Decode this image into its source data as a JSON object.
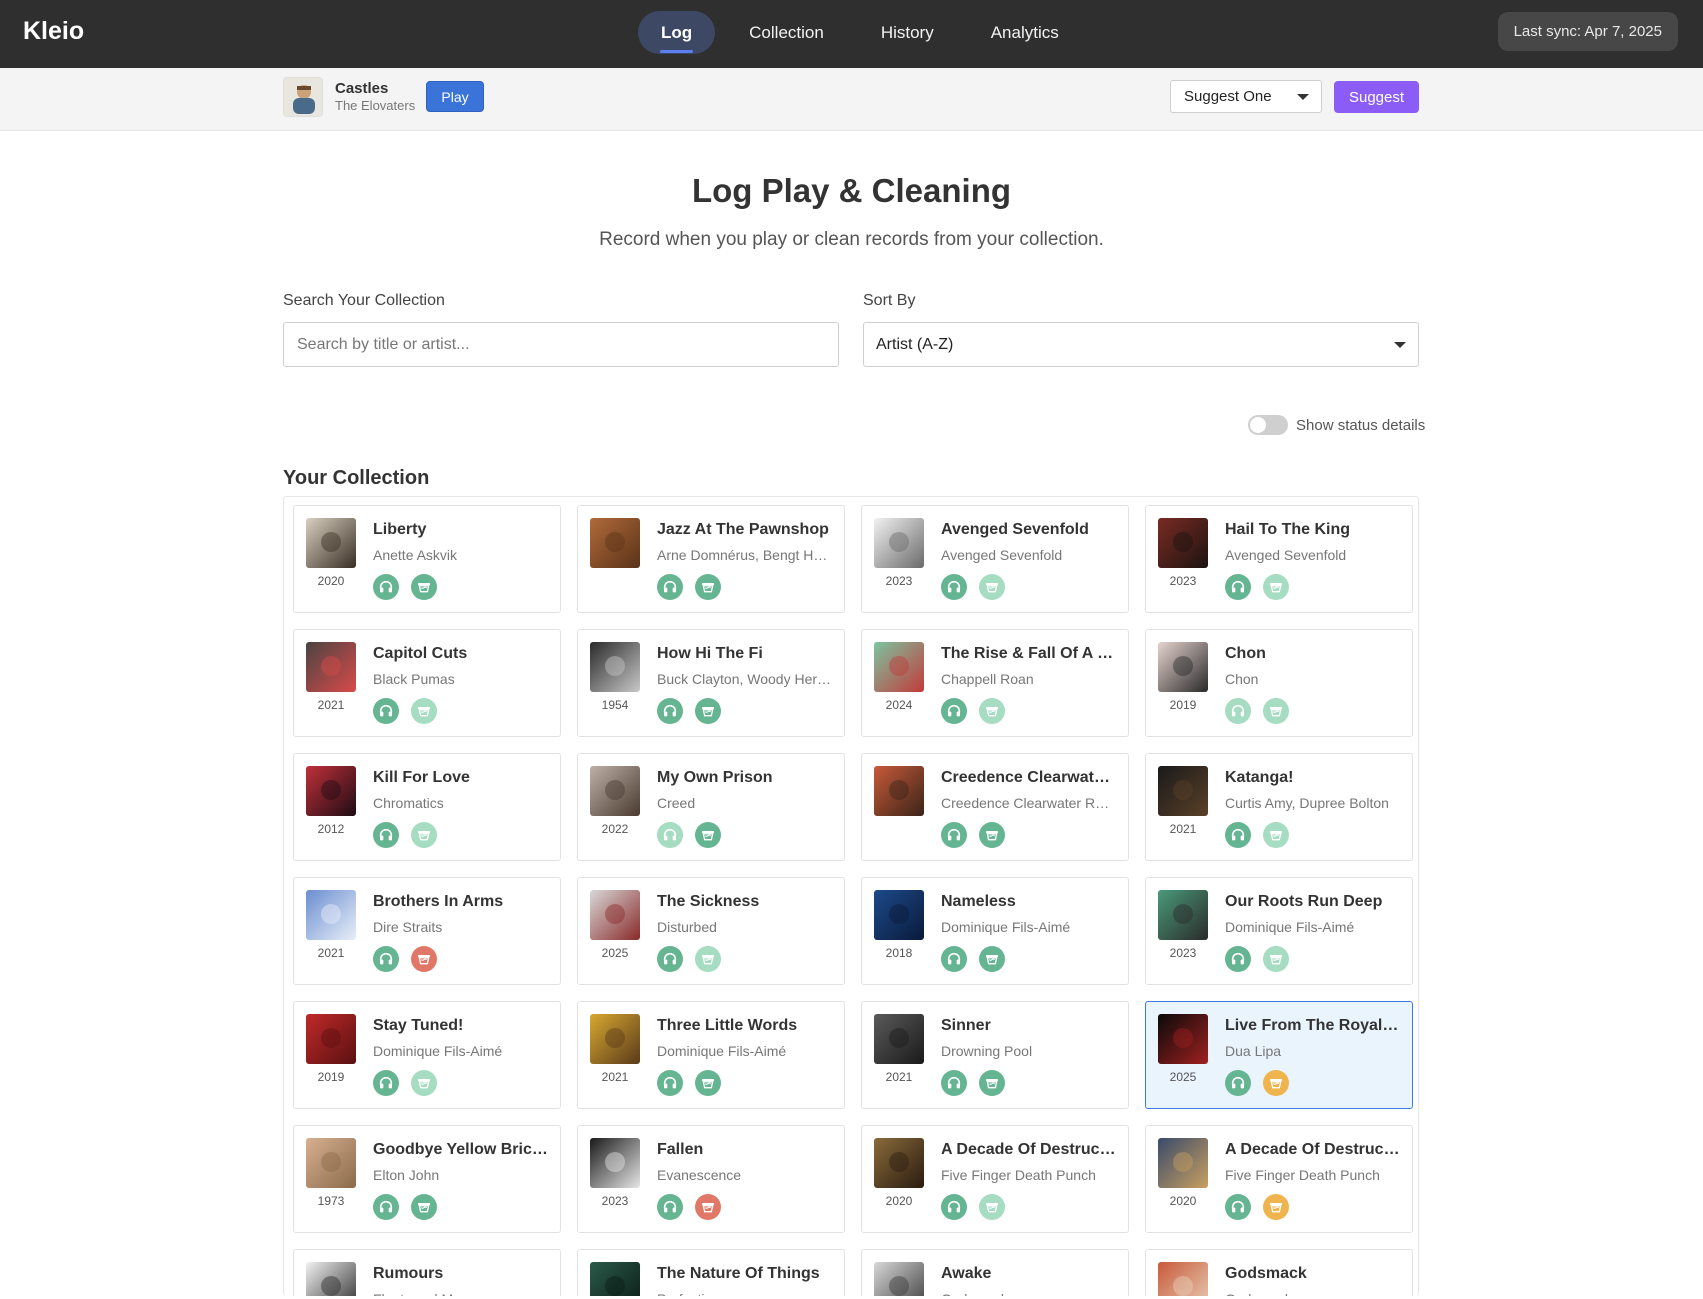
{
  "app": {
    "name": "Kleio"
  },
  "nav": {
    "items": [
      "Log",
      "Collection",
      "History",
      "Analytics"
    ],
    "active": "Log"
  },
  "sync": {
    "label": "Last sync: Apr 7, 2025"
  },
  "now_playing": {
    "title": "Castles",
    "artist": "The Elovaters",
    "play_label": "Play"
  },
  "suggest": {
    "selected": "Suggest One",
    "button_label": "Suggest"
  },
  "page": {
    "title": "Log Play & Cleaning",
    "subtitle": "Record when you play or clean records from your collection."
  },
  "search": {
    "label": "Search Your Collection",
    "placeholder": "Search by title or artist...",
    "value": ""
  },
  "sort": {
    "label": "Sort By",
    "selected": "Artist (A-Z)"
  },
  "status_toggle": {
    "label": "Show status details",
    "on": false
  },
  "collection": {
    "heading": "Your Collection",
    "status_colors": {
      "dark": "#66b592",
      "light": "#a6dcc1",
      "red": "#e07767",
      "amber": "#f0b44f"
    },
    "records": [
      {
        "title": "Liberty",
        "artist": "Anette Askvik",
        "year": "2020",
        "play": "dark",
        "clean": "dark",
        "art": [
          "#d8d0c0",
          "#3a2e24"
        ]
      },
      {
        "title": "Jazz At The Pawnshop",
        "artist": "Arne Domnérus, Bengt H…",
        "year": "",
        "play": "dark",
        "clean": "dark",
        "art": [
          "#b06a3a",
          "#5a3218"
        ]
      },
      {
        "title": "Avenged Sevenfold",
        "artist": "Avenged Sevenfold",
        "year": "2023",
        "play": "dark",
        "clean": "light",
        "art": [
          "#f2f2f2",
          "#6a6a6a"
        ]
      },
      {
        "title": "Hail To The King",
        "artist": "Avenged Sevenfold",
        "year": "2023",
        "play": "dark",
        "clean": "light",
        "art": [
          "#7a2a24",
          "#1c1410"
        ]
      },
      {
        "title": "Capitol Cuts",
        "artist": "Black Pumas",
        "year": "2021",
        "play": "dark",
        "clean": "light",
        "art": [
          "#4a4442",
          "#d94a4a"
        ]
      },
      {
        "title": "How Hi The Fi",
        "artist": "Buck Clayton, Woody Her…",
        "year": "1954",
        "play": "dark",
        "clean": "dark",
        "art": [
          "#2a2a2a",
          "#c8c8c8"
        ]
      },
      {
        "title": "The Rise & Fall Of A …",
        "artist": "Chappell Roan",
        "year": "2024",
        "play": "dark",
        "clean": "light",
        "art": [
          "#7cc4a0",
          "#c23a3a"
        ]
      },
      {
        "title": "Chon",
        "artist": "Chon",
        "year": "2019",
        "play": "light",
        "clean": "light",
        "art": [
          "#e6d4d0",
          "#2a2a2a"
        ]
      },
      {
        "title": "Kill For Love",
        "artist": "Chromatics",
        "year": "2012",
        "play": "dark",
        "clean": "light",
        "art": [
          "#c0303a",
          "#1e0c14"
        ]
      },
      {
        "title": "My Own Prison",
        "artist": "Creed",
        "year": "2022",
        "play": "light",
        "clean": "dark",
        "art": [
          "#bdb0a6",
          "#4a3a30"
        ]
      },
      {
        "title": "Creedence Clearwat…",
        "artist": "Creedence Clearwater R…",
        "year": "",
        "play": "dark",
        "clean": "dark",
        "art": [
          "#c85a3a",
          "#3a2418"
        ]
      },
      {
        "title": "Katanga!",
        "artist": "Curtis Amy, Dupree Bolton",
        "year": "2021",
        "play": "dark",
        "clean": "light",
        "art": [
          "#1a1a1a",
          "#5a4028"
        ]
      },
      {
        "title": "Brothers In Arms",
        "artist": "Dire Straits",
        "year": "2021",
        "play": "dark",
        "clean": "red",
        "art": [
          "#6a8ed0",
          "#e8eef8"
        ]
      },
      {
        "title": "The Sickness",
        "artist": "Disturbed",
        "year": "2025",
        "play": "dark",
        "clean": "light",
        "art": [
          "#d8d8d8",
          "#8a2a2a"
        ]
      },
      {
        "title": "Nameless",
        "artist": "Dominique Fils-Aimé",
        "year": "2018",
        "play": "dark",
        "clean": "dark",
        "art": [
          "#1c4a8a",
          "#0a1a3a"
        ]
      },
      {
        "title": "Our Roots Run Deep",
        "artist": "Dominique Fils-Aimé",
        "year": "2023",
        "play": "dark",
        "clean": "light",
        "art": [
          "#4a9a7a",
          "#2a2a2a"
        ]
      },
      {
        "title": "Stay Tuned!",
        "artist": "Dominique Fils-Aimé",
        "year": "2019",
        "play": "dark",
        "clean": "light",
        "art": [
          "#c02a2a",
          "#5a1010"
        ]
      },
      {
        "title": "Three Little Words",
        "artist": "Dominique Fils-Aimé",
        "year": "2021",
        "play": "dark",
        "clean": "dark",
        "art": [
          "#d8a830",
          "#5a3a1a"
        ]
      },
      {
        "title": "Sinner",
        "artist": "Drowning Pool",
        "year": "2021",
        "play": "dark",
        "clean": "dark",
        "art": [
          "#5a5a5a",
          "#1a1a1a"
        ]
      },
      {
        "title": "Live From The Royal…",
        "artist": "Dua Lipa",
        "year": "2025",
        "play": "dark",
        "clean": "amber",
        "art": [
          "#0a0a0a",
          "#a02020"
        ],
        "selected": true
      },
      {
        "title": "Goodbye Yellow Bric…",
        "artist": "Elton John",
        "year": "1973",
        "play": "dark",
        "clean": "dark",
        "art": [
          "#d8b090",
          "#8a6a4a"
        ]
      },
      {
        "title": "Fallen",
        "artist": "Evanescence",
        "year": "2023",
        "play": "dark",
        "clean": "red",
        "art": [
          "#1a1a1a",
          "#e6e6e6"
        ]
      },
      {
        "title": "A Decade Of Destruc…",
        "artist": "Five Finger Death Punch",
        "year": "2020",
        "play": "dark",
        "clean": "light",
        "art": [
          "#8a6a3a",
          "#2a1c10"
        ]
      },
      {
        "title": "A Decade Of Destruc…",
        "artist": "Five Finger Death Punch",
        "year": "2020",
        "play": "dark",
        "clean": "amber",
        "art": [
          "#3a4a6a",
          "#c8a060"
        ]
      },
      {
        "title": "Rumours",
        "artist": "Fleetwood Mac",
        "year": "",
        "play": "dark",
        "clean": "dark",
        "art": [
          "#f2f2f2",
          "#2a2a2a"
        ]
      },
      {
        "title": "The Nature Of Things",
        "artist": "Perfection",
        "year": "",
        "play": "dark",
        "clean": "dark",
        "art": [
          "#2a5a4a",
          "#0a1a14"
        ]
      },
      {
        "title": "Awake",
        "artist": "Godsmack",
        "year": "",
        "play": "dark",
        "clean": "dark",
        "art": [
          "#d8d8d8",
          "#3a3a3a"
        ]
      },
      {
        "title": "Godsmack",
        "artist": "Godsmack",
        "year": "",
        "play": "dark",
        "clean": "dark",
        "art": [
          "#c85a3a",
          "#e8d0b8"
        ]
      }
    ]
  }
}
